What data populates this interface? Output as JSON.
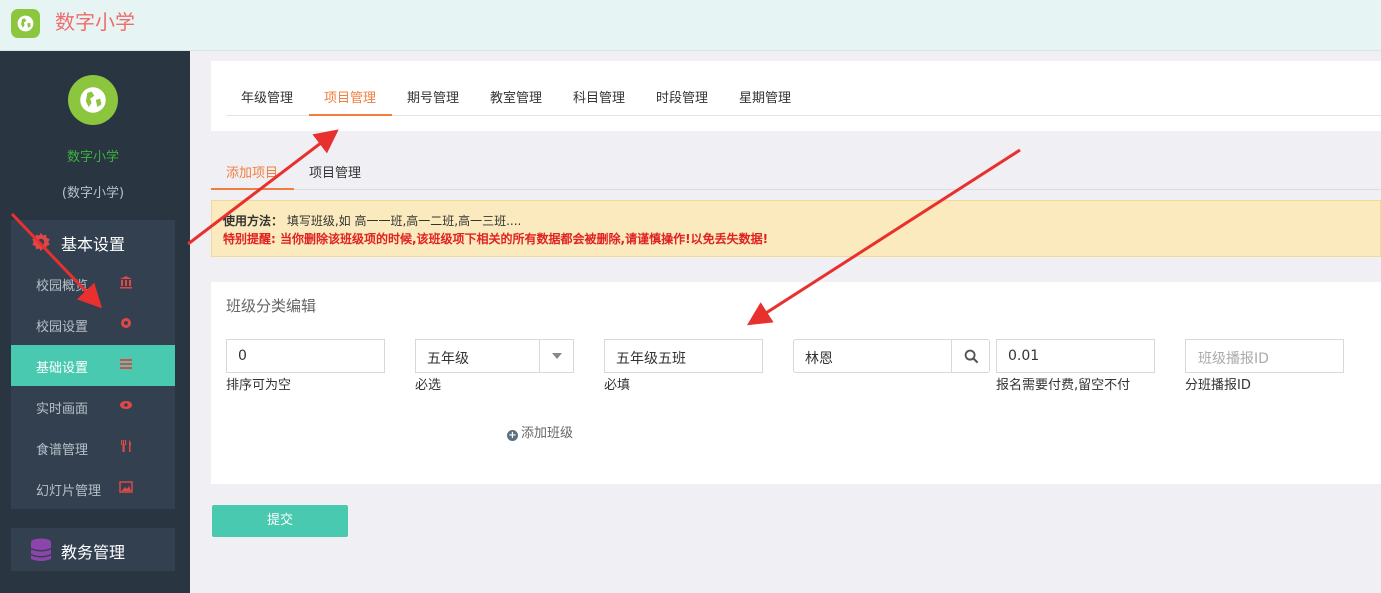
{
  "app": {
    "title": "数字小学"
  },
  "sidebar": {
    "school_name": "数字小学",
    "school_sub": "(数字小学)",
    "group_basic": "基本设置",
    "items": [
      {
        "label": "校园概览",
        "icon": "bank-icon"
      },
      {
        "label": "校园设置",
        "icon": "gear-icon"
      },
      {
        "label": "基础设置",
        "icon": "list-icon"
      },
      {
        "label": "实时画面",
        "icon": "eye-icon"
      },
      {
        "label": "食谱管理",
        "icon": "cutlery-icon"
      },
      {
        "label": "幻灯片管理",
        "icon": "image-icon"
      }
    ],
    "group_affairs": "教务管理"
  },
  "tabs": [
    "年级管理",
    "项目管理",
    "期号管理",
    "教室管理",
    "科目管理",
    "时段管理",
    "星期管理"
  ],
  "active_tab": "项目管理",
  "subtabs": [
    "添加项目",
    "项目管理"
  ],
  "active_subtab": "添加项目",
  "notice": {
    "usage_label": "使用方法：",
    "usage_text": "填写班级,如 高一一班,高一二班,高一三班....",
    "warning": "特别提醒: 当你删除该班级项的时候,该班级项下相关的所有数据都会被删除,请谨慎操作!以免丢失数据!"
  },
  "form": {
    "panel_title": "班级分类编辑",
    "sort_value": "0",
    "sort_hint": "排序可为空",
    "grade_value": "五年级",
    "grade_hint": "必选",
    "class_value": "五年级五班",
    "class_hint": "必填",
    "teacher_value": "林恩",
    "fee_value": "0.01",
    "fee_hint": "报名需要付费,留空不付",
    "broadcast_placeholder": "班级播报ID",
    "broadcast_hint": "分班播报ID",
    "add_class": "添加班级",
    "submit": "提交"
  },
  "colors": {
    "accent": "#48c9b0",
    "active_tab": "#f07e3e",
    "sidebar": "#2a3542",
    "warning": "#e02222",
    "arrow": "#e8312f"
  }
}
